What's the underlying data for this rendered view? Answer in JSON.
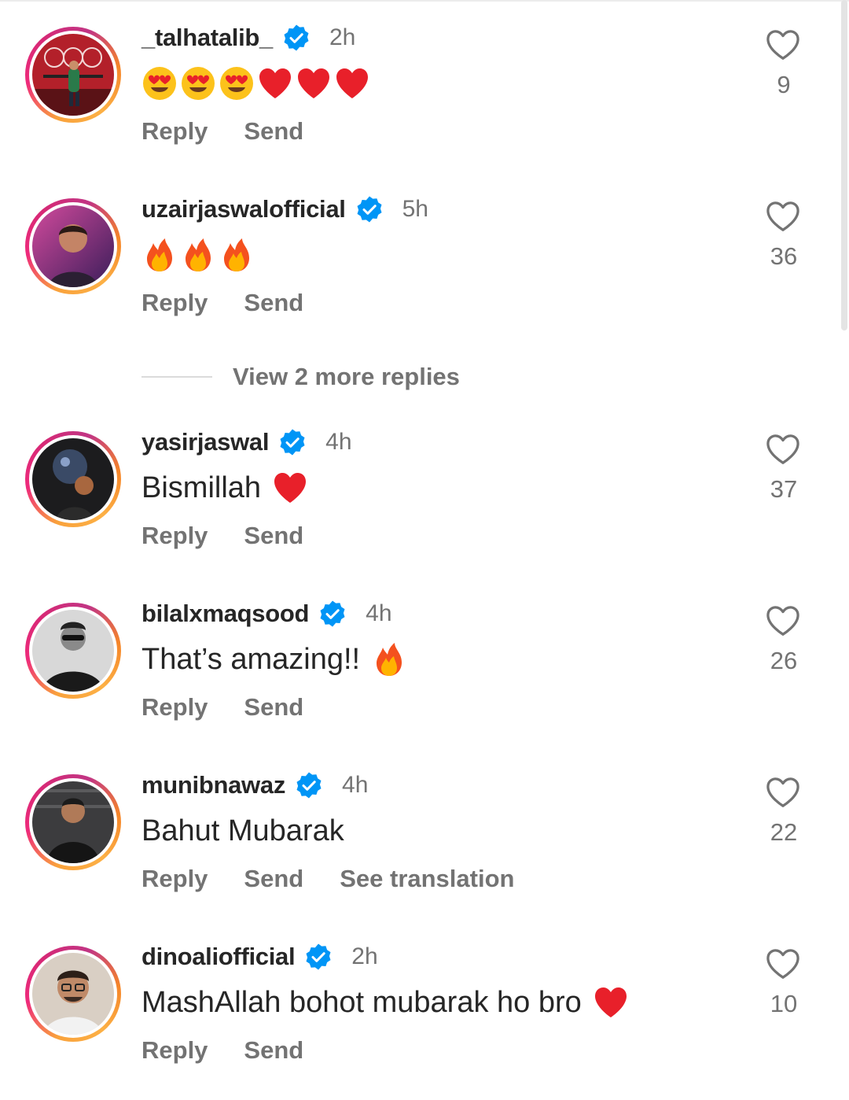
{
  "view_more_replies": "View 2 more replies",
  "actions": {
    "reply": "Reply",
    "send": "Send",
    "see_translation": "See translation"
  },
  "colors": {
    "verified": "#0095f6",
    "secondary_text": "#737373",
    "primary_text": "#262626"
  },
  "comments": [
    {
      "username": "_talhatalib_",
      "time": "2h",
      "text": "",
      "emojis": [
        "heart-eyes",
        "heart-eyes",
        "heart-eyes",
        "red-heart",
        "red-heart",
        "red-heart"
      ],
      "likes": "9",
      "verified": true
    },
    {
      "username": "uzairjaswalofficial",
      "time": "5h",
      "text": "",
      "emojis": [
        "fire",
        "fire",
        "fire"
      ],
      "likes": "36",
      "verified": true
    },
    {
      "username": "yasirjaswal",
      "time": "4h",
      "text": "Bismillah",
      "emojis": [
        "red-heart"
      ],
      "likes": "37",
      "verified": true
    },
    {
      "username": "bilalxmaqsood",
      "time": "4h",
      "text": "That’s amazing!!",
      "emojis": [
        "fire"
      ],
      "likes": "26",
      "verified": true
    },
    {
      "username": "munibnawaz",
      "time": "4h",
      "text": "Bahut Mubarak",
      "emojis": [],
      "likes": "22",
      "verified": true,
      "translation": true
    },
    {
      "username": "dinoaliofficial",
      "time": "2h",
      "text": "MashAllah bohot mubarak ho bro",
      "emojis": [
        "red-heart"
      ],
      "likes": "10",
      "verified": true
    }
  ]
}
